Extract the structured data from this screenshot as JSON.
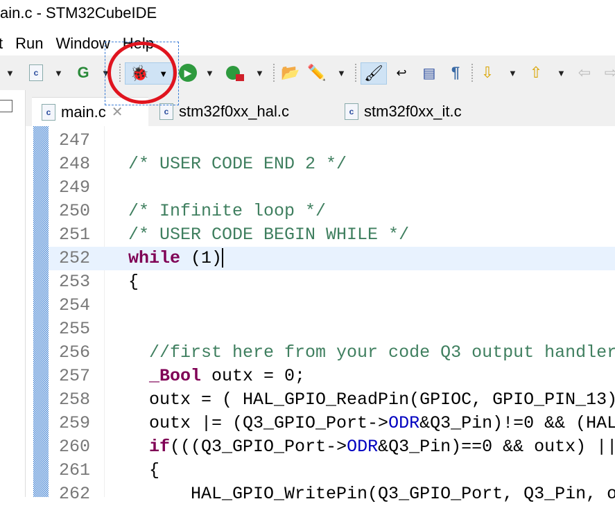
{
  "window": {
    "title": "ain.c - STM32CubeIDE"
  },
  "menu": [
    "t",
    "Run",
    "Window",
    "Help"
  ],
  "toolbar": {
    "icons": [
      "new-c-file",
      "new-class",
      "debug",
      "run",
      "external-tools",
      "open-perspective",
      "toggle-mark",
      "highlight",
      "word-wrap",
      "block-select",
      "show-whitespace",
      "next-annotation",
      "previous-annotation",
      "back",
      "forward"
    ]
  },
  "tabs": [
    {
      "label": "main.c",
      "active": true
    },
    {
      "label": "stm32f0xx_hal.c"
    },
    {
      "label": "stm32f0xx_it.c"
    }
  ],
  "code": [
    {
      "n": "247",
      "segs": []
    },
    {
      "n": "248",
      "segs": [
        {
          "c": "cm",
          "t": "/* USER CODE END 2 */"
        }
      ]
    },
    {
      "n": "249",
      "segs": []
    },
    {
      "n": "250",
      "segs": [
        {
          "c": "cm",
          "t": "/* Infinite loop */"
        }
      ]
    },
    {
      "n": "251",
      "segs": [
        {
          "c": "cm",
          "t": "/* USER CODE BEGIN WHILE */"
        }
      ]
    },
    {
      "n": "252",
      "cur": true,
      "segs": [
        {
          "c": "kw",
          "t": "while"
        },
        {
          "c": "",
          "t": " (1)"
        }
      ]
    },
    {
      "n": "253",
      "segs": [
        {
          "c": "",
          "t": "{"
        }
      ]
    },
    {
      "n": "254",
      "segs": []
    },
    {
      "n": "255",
      "segs": []
    },
    {
      "n": "256",
      "segs": [
        {
          "c": "cm",
          "t": "  //first here from your code Q3 output handler"
        }
      ]
    },
    {
      "n": "257",
      "segs": [
        {
          "c": "",
          "t": "  "
        },
        {
          "c": "kw",
          "t": "_Bool"
        },
        {
          "c": "",
          "t": " outx = 0;"
        }
      ]
    },
    {
      "n": "258",
      "segs": [
        {
          "c": "",
          "t": "  outx = ( HAL_GPIO_ReadPin(GPIOC, GPIO_PIN_13)"
        }
      ]
    },
    {
      "n": "259",
      "segs": [
        {
          "c": "",
          "t": "  outx |= (Q3_GPIO_Port->"
        },
        {
          "c": "fld",
          "t": "ODR"
        },
        {
          "c": "",
          "t": "&Q3_Pin)!=0 && (HAL"
        }
      ]
    },
    {
      "n": "260",
      "segs": [
        {
          "c": "",
          "t": "  "
        },
        {
          "c": "kw",
          "t": "if"
        },
        {
          "c": "",
          "t": "(((Q3_GPIO_Port->"
        },
        {
          "c": "fld",
          "t": "ODR"
        },
        {
          "c": "",
          "t": "&Q3_Pin)==0 && outx) ||"
        }
      ]
    },
    {
      "n": "261",
      "segs": [
        {
          "c": "",
          "t": "  {"
        }
      ]
    },
    {
      "n": "262",
      "segs": [
        {
          "c": "",
          "t": "      HAL_GPIO_WritePin(Q3_GPIO_Port, Q3_Pin, o"
        }
      ]
    }
  ]
}
